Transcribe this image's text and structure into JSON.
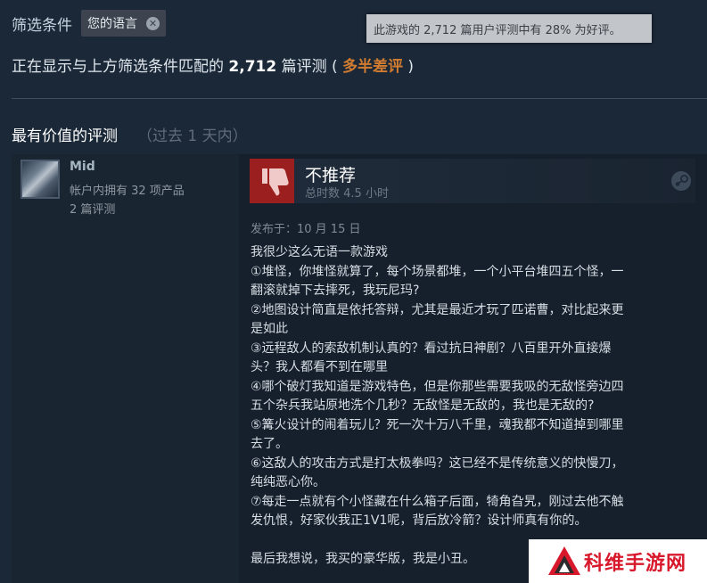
{
  "filter": {
    "label": "筛选条件",
    "chip_label": "您的语言",
    "chip_close_glyph": "✕"
  },
  "tooltip": {
    "text": "此游戏的 2,712 篇用户评测中有 28% 为好评。"
  },
  "summary": {
    "prefix": "正在显示与上方筛选条件匹配的 ",
    "count": "2,712",
    "suffix": " 篇评测 ( ",
    "verdict": "多半差评",
    "close": " )",
    "verdict_color": "#d27c30"
  },
  "section": {
    "title": "最有价值的评测",
    "subtitle": "（过去 1 天内）"
  },
  "review": {
    "author": "Mid",
    "products_owned": "帐户内拥有 32 项产品",
    "review_count": "2 篇评测",
    "recommendation": "不推荐",
    "playtime": "总时数 4.5 小时",
    "posted": "发布于：10 月 15 日",
    "thumb_icon": "thumbs-down-icon",
    "thumb_color": "#9c1f1f",
    "lines": [
      "我很少这么无语一款游戏",
      "①堆怪，你堆怪就算了，每个场景都堆，一个小平台堆四五个怪，一",
      "翻滚就掉下去摔死，我玩尼玛?",
      "②地图设计简直是依托答辩，尤其是最近才玩了匹诺曹，对比起来更",
      "是如此",
      "③远程敌人的索敌机制认真的？看过抗日神剧？八百里开外直接爆",
      "头？我人都看不到在哪里",
      "④哪个破灯我知道是游戏特色，但是你那些需要我吸的无敌怪旁边四",
      "五个杂兵我站原地洗个几秒？无敌怪是无敌的，我也是无敌的?",
      "⑤篝火设计的闹着玩儿？死一次十万八千里，魂我都不知道掉到哪里",
      "去了。",
      "⑥这敌人的攻击方式是打太极拳吗？这已经不是传统意义的快慢刀，",
      "纯纯恶心你。",
      "⑦每走一点就有个小怪藏在什么箱子后面，犄角旮旯，刚过去他不触",
      "发仇恨，好家伙我正1V1呢，背后放冷箭？设计师真有你的。",
      "",
      "最后我想说，我买的豪华版，我是小丑。"
    ]
  },
  "watermark": {
    "text": "科维手游网",
    "color": "#d8182b"
  }
}
